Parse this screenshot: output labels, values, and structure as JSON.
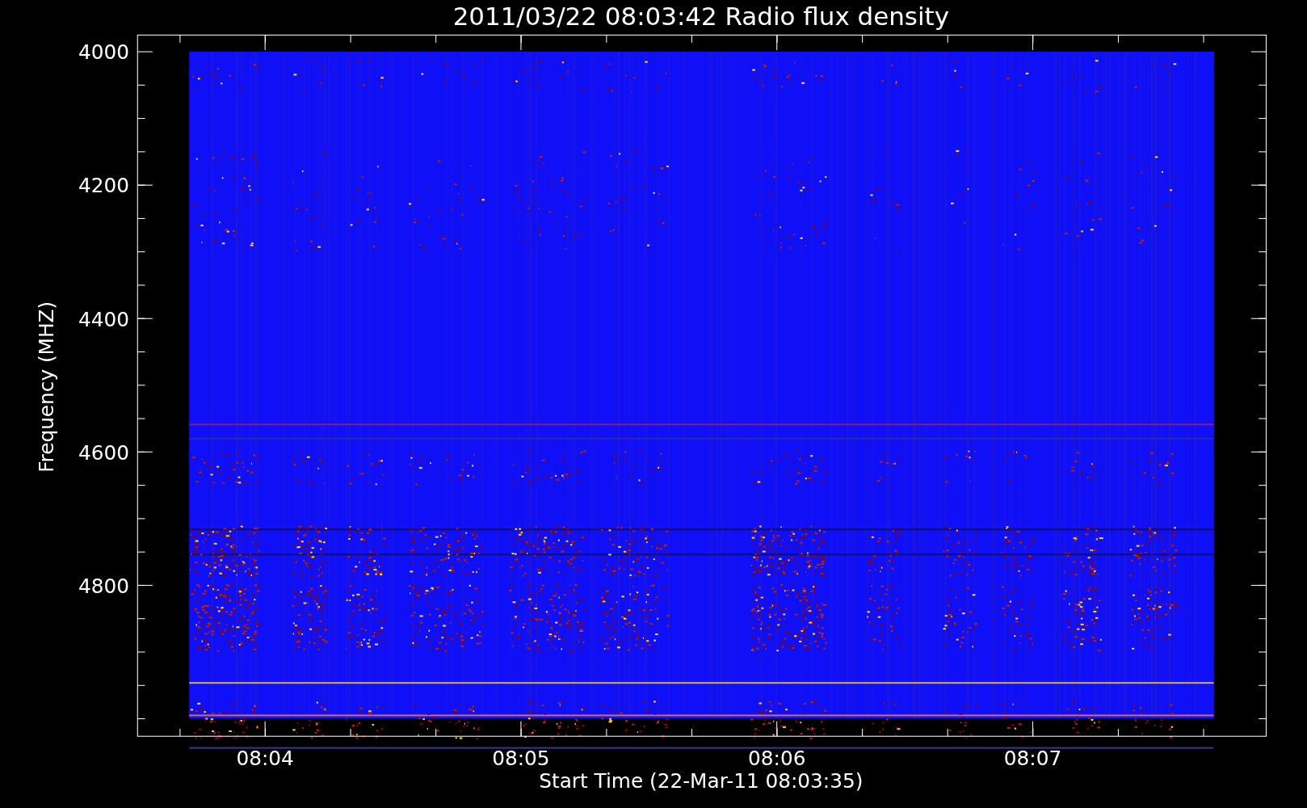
{
  "title": "2011/03/22 08:03:42 Radio flux density",
  "y_axis": {
    "label": "Frequency (MHZ)",
    "ticks": [
      "4000",
      "4200",
      "4400",
      "4600",
      "4800"
    ]
  },
  "x_axis": {
    "label": "Start Time (22-Mar-11 08:03:35)",
    "ticks": [
      "08:04",
      "08:05",
      "08:06",
      "08:07"
    ]
  }
}
